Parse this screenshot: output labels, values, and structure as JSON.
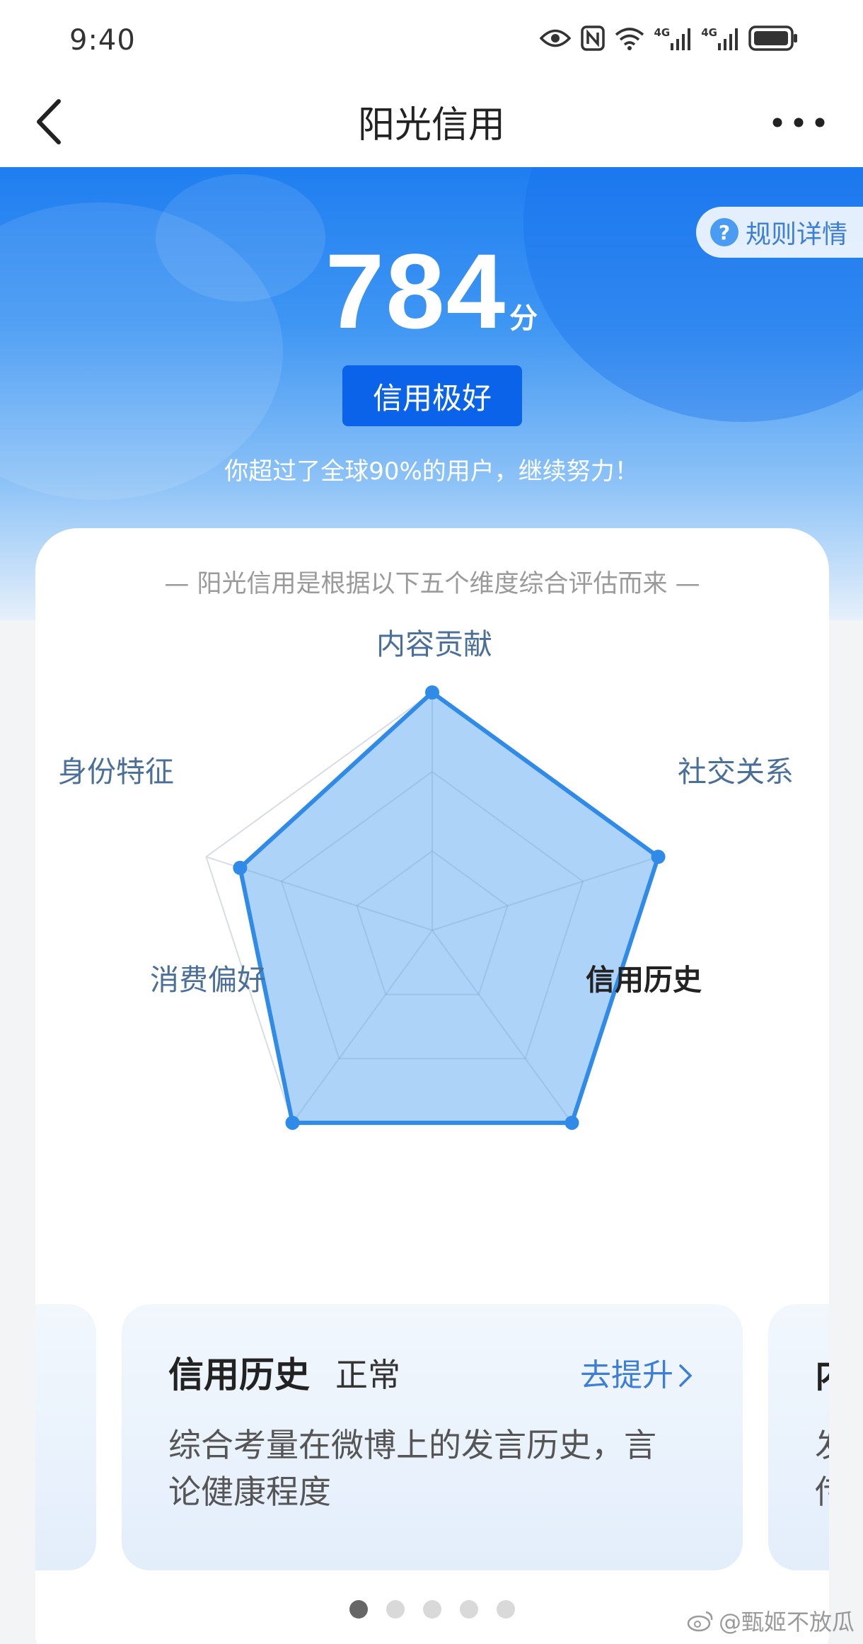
{
  "status_bar": {
    "time": "9:40",
    "icons": [
      "eye-icon",
      "nfc-icon",
      "wifi-icon",
      "signal-4g-icon",
      "signal-4g-icon",
      "battery-icon"
    ],
    "network_label": "4G"
  },
  "nav": {
    "title": "阳光信用",
    "back_icon": "chevron-left-icon",
    "more_icon": "more-dots-icon"
  },
  "hero": {
    "rules_label": "规则详情",
    "rules_icon": "question-icon",
    "score": "784",
    "score_unit": "分",
    "level": "信用极好",
    "tip": "你超过了全球90%的用户，继续努力！"
  },
  "card": {
    "subtitle": "— 阳光信用是根据以下五个维度综合评估而来 —"
  },
  "chart_data": {
    "type": "radar",
    "axes": [
      "内容贡献",
      "社交关系",
      "信用历史",
      "消费偏好",
      "身份特征"
    ],
    "values": [
      1.0,
      1.0,
      1.0,
      1.0,
      0.85
    ],
    "max": 1.0,
    "rings": 3,
    "highlighted_axis": "信用历史",
    "colors": {
      "fill": "#a9d1f9",
      "stroke": "#2f8ae8",
      "grid": "#d8dde3"
    }
  },
  "carousel": {
    "current": {
      "title": "信用历史",
      "status": "正常",
      "link": "去提升",
      "desc_line1": "综合考量在微博上的发言历史，言",
      "desc_line2": "论健康程度"
    },
    "next_peek": {
      "title_char": "内",
      "desc_char1": "发",
      "desc_char2": "传"
    },
    "page_count": 5,
    "active_page": 0
  },
  "watermark": {
    "text": "@甄姬不放瓜",
    "icon": "weibo-icon"
  }
}
